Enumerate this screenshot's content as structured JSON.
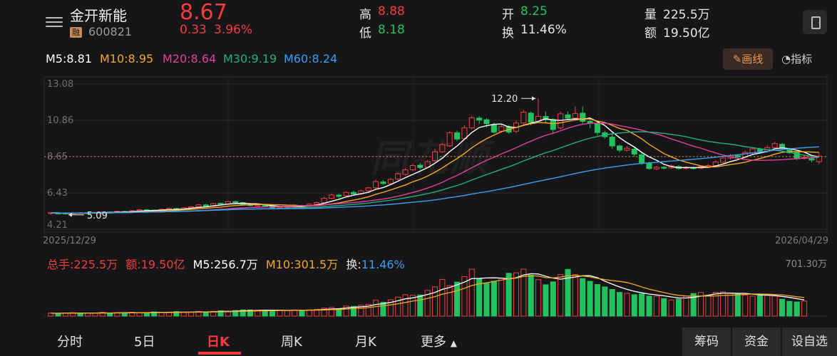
{
  "header": {
    "stock_name": "金开新能",
    "badge": "融",
    "stock_code": "600821",
    "price": "8.67",
    "change": "0.33",
    "change_pct": "3.96%",
    "high_label": "高",
    "high_value": "8.88",
    "low_label": "低",
    "low_value": "8.18",
    "open_label": "开",
    "open_value": "8.25",
    "turnover_label": "换",
    "turnover_value": "11.46%",
    "volume_label": "量",
    "volume_value": "225.5万",
    "amount_label": "额",
    "amount_value": "19.50亿"
  },
  "ma": {
    "m5": "M5:8.81",
    "m10": "M10:8.95",
    "m20": "M20:8.64",
    "m30": "M30:9.19",
    "m60": "M60:8.24"
  },
  "tools": {
    "draw": "画线",
    "indicator": "指标"
  },
  "watermark": "同花顺",
  "colors": {
    "up": "#f23d3d",
    "down": "#22c35e",
    "m5": "#ffffff",
    "m10": "#f5a623",
    "m20": "#e0409a",
    "m30": "#22b07d",
    "m60": "#3d9df0"
  },
  "chart_data": {
    "type": "candlestick",
    "y_ticks": [
      "13.08",
      "10.86",
      "8.65",
      "6.43",
      "4.21"
    ],
    "ylim": [
      4.21,
      13.08
    ],
    "current_price": 8.65,
    "x_start": "2025/12/29",
    "x_end": "2026/04/29",
    "max_annotation": "12.20",
    "max_value": 12.2,
    "min_annotation": "5.09",
    "min_value": 5.09,
    "candles": [
      [
        5.18,
        5.22,
        5.1,
        5.24
      ],
      [
        5.2,
        5.19,
        5.15,
        5.25
      ],
      [
        5.2,
        5.16,
        5.09,
        5.24
      ],
      [
        5.16,
        5.2,
        5.12,
        5.24
      ],
      [
        5.18,
        5.22,
        5.14,
        5.25
      ],
      [
        5.22,
        5.2,
        5.15,
        5.26
      ],
      [
        5.2,
        5.24,
        5.16,
        5.28
      ],
      [
        5.24,
        5.26,
        5.2,
        5.3
      ],
      [
        5.26,
        5.24,
        5.2,
        5.3
      ],
      [
        5.24,
        5.3,
        5.2,
        5.34
      ],
      [
        5.3,
        5.28,
        5.22,
        5.34
      ],
      [
        5.28,
        5.34,
        5.24,
        5.38
      ],
      [
        5.34,
        5.4,
        5.3,
        5.45
      ],
      [
        5.4,
        5.38,
        5.32,
        5.44
      ],
      [
        5.38,
        5.36,
        5.3,
        5.42
      ],
      [
        5.36,
        5.42,
        5.32,
        5.48
      ],
      [
        5.42,
        5.48,
        5.38,
        5.52
      ],
      [
        5.48,
        5.44,
        5.4,
        5.52
      ],
      [
        5.44,
        5.52,
        5.4,
        5.56
      ],
      [
        5.52,
        5.58,
        5.46,
        5.62
      ],
      [
        5.58,
        5.7,
        5.52,
        5.76
      ],
      [
        5.7,
        5.62,
        5.56,
        5.76
      ],
      [
        5.62,
        5.78,
        5.58,
        5.82
      ],
      [
        5.8,
        5.74,
        5.68,
        5.84
      ],
      [
        5.74,
        5.9,
        5.7,
        5.96
      ],
      [
        5.9,
        5.84,
        5.76,
        5.96
      ],
      [
        5.84,
        5.72,
        5.66,
        5.88
      ],
      [
        5.72,
        5.66,
        5.6,
        5.78
      ],
      [
        5.66,
        5.7,
        5.6,
        5.76
      ],
      [
        5.7,
        5.62,
        5.56,
        5.74
      ],
      [
        5.62,
        5.52,
        5.46,
        5.66
      ],
      [
        5.52,
        5.56,
        5.48,
        5.62
      ],
      [
        5.56,
        5.6,
        5.5,
        5.64
      ],
      [
        5.6,
        5.66,
        5.54,
        5.72
      ],
      [
        5.66,
        5.62,
        5.56,
        5.7
      ],
      [
        5.64,
        5.74,
        5.6,
        5.8
      ],
      [
        5.74,
        5.84,
        5.7,
        5.9
      ],
      [
        5.84,
        6.1,
        5.8,
        6.2
      ],
      [
        6.1,
        6.3,
        6.04,
        6.4
      ],
      [
        6.3,
        6.22,
        6.1,
        6.38
      ],
      [
        6.26,
        6.46,
        6.2,
        6.52
      ],
      [
        6.46,
        6.36,
        6.28,
        6.56
      ],
      [
        6.38,
        6.56,
        6.3,
        6.62
      ],
      [
        6.56,
        6.74,
        6.5,
        6.8
      ],
      [
        6.74,
        7.12,
        6.68,
        7.24
      ],
      [
        7.1,
        7.0,
        6.92,
        7.22
      ],
      [
        7.0,
        7.26,
        6.94,
        7.34
      ],
      [
        7.28,
        7.6,
        7.2,
        7.66
      ],
      [
        7.56,
        7.84,
        7.48,
        7.94
      ],
      [
        7.84,
        8.1,
        7.76,
        8.2
      ],
      [
        8.12,
        7.98,
        7.88,
        8.24
      ],
      [
        8.0,
        8.34,
        7.94,
        8.44
      ],
      [
        8.4,
        8.94,
        8.32,
        9.12
      ],
      [
        8.94,
        9.38,
        8.88,
        9.48
      ],
      [
        9.3,
        10.1,
        9.24,
        10.2
      ],
      [
        10.1,
        9.72,
        9.6,
        10.24
      ],
      [
        9.74,
        10.4,
        9.68,
        10.56
      ],
      [
        10.4,
        11.02,
        10.3,
        11.14
      ],
      [
        11.0,
        10.88,
        10.64,
        11.12
      ],
      [
        10.9,
        10.66,
        10.42,
        11.0
      ],
      [
        10.6,
        10.14,
        10.04,
        10.72
      ],
      [
        10.2,
        10.48,
        10.1,
        10.62
      ],
      [
        10.48,
        10.14,
        10.04,
        10.58
      ],
      [
        10.2,
        10.7,
        10.08,
        10.84
      ],
      [
        10.7,
        11.36,
        10.6,
        11.5
      ],
      [
        11.3,
        10.74,
        10.56,
        11.4
      ],
      [
        10.8,
        11.1,
        10.7,
        12.2
      ],
      [
        11.1,
        10.9,
        10.7,
        11.4
      ],
      [
        10.92,
        10.3,
        10.1,
        11.0
      ],
      [
        10.4,
        11.26,
        10.3,
        11.4
      ],
      [
        11.2,
        11.0,
        10.86,
        11.4
      ],
      [
        11.0,
        11.28,
        10.9,
        11.7
      ],
      [
        11.3,
        10.8,
        10.6,
        11.7
      ],
      [
        10.8,
        10.7,
        10.4,
        10.94
      ],
      [
        10.66,
        10.12,
        9.94,
        10.8
      ],
      [
        10.1,
        9.86,
        9.74,
        10.22
      ],
      [
        9.84,
        9.3,
        9.12,
        10.06
      ],
      [
        9.3,
        9.04,
        8.9,
        9.4
      ],
      [
        9.04,
        9.16,
        8.96,
        9.3
      ],
      [
        9.1,
        8.8,
        8.66,
        9.2
      ],
      [
        8.76,
        8.24,
        8.14,
        8.9
      ],
      [
        8.24,
        7.92,
        7.84,
        8.34
      ],
      [
        7.9,
        8.0,
        7.82,
        8.08
      ],
      [
        8.0,
        7.94,
        7.86,
        8.06
      ],
      [
        7.96,
        8.08,
        7.9,
        8.16
      ],
      [
        8.04,
        7.92,
        7.84,
        8.12
      ],
      [
        7.94,
        7.98,
        7.86,
        8.06
      ],
      [
        7.98,
        7.92,
        7.86,
        8.06
      ],
      [
        7.94,
        8.04,
        7.88,
        8.12
      ],
      [
        8.04,
        8.1,
        7.96,
        8.18
      ],
      [
        8.1,
        8.32,
        8.04,
        8.4
      ],
      [
        8.3,
        8.56,
        8.24,
        8.66
      ],
      [
        8.56,
        8.7,
        8.46,
        8.8
      ],
      [
        8.7,
        8.62,
        8.52,
        8.8
      ],
      [
        8.62,
        8.9,
        8.56,
        9.02
      ],
      [
        8.88,
        9.12,
        8.8,
        9.2
      ],
      [
        9.1,
        8.98,
        8.88,
        9.2
      ],
      [
        8.98,
        9.2,
        8.9,
        9.34
      ],
      [
        9.2,
        9.44,
        9.1,
        9.56
      ],
      [
        9.4,
        9.16,
        9.06,
        9.48
      ],
      [
        9.14,
        8.88,
        8.8,
        9.2
      ],
      [
        8.9,
        8.52,
        8.44,
        8.96
      ],
      [
        8.54,
        8.6,
        8.46,
        8.72
      ],
      [
        8.52,
        8.44,
        8.3,
        8.64
      ],
      [
        8.34,
        8.67,
        8.18,
        8.88
      ]
    ]
  },
  "volume": {
    "total": "总手:225.5万",
    "amount": "额:19.50亿",
    "m5": "M5:256.7万",
    "m10": "M10:301.5万",
    "turnover_label": "换:",
    "turnover_value": "11.46%",
    "max": "701.30万",
    "max_value": 701.3,
    "bars": [
      44,
      40,
      46,
      52,
      42,
      48,
      46,
      56,
      44,
      50,
      52,
      58,
      48,
      54,
      62,
      56,
      60,
      66,
      54,
      62,
      70,
      64,
      72,
      80,
      68,
      84,
      94,
      92,
      88,
      86,
      84,
      90,
      82,
      92,
      88,
      94,
      100,
      120,
      128,
      112,
      150,
      146,
      162,
      176,
      236,
      208,
      244,
      284,
      320,
      312,
      316,
      384,
      436,
      548,
      456,
      508,
      590,
      700,
      560,
      490,
      520,
      566,
      640,
      646,
      701,
      614,
      544,
      468,
      512,
      620,
      698,
      620,
      560,
      520,
      472,
      436,
      398,
      354,
      340,
      320,
      332,
      300,
      298,
      262,
      242,
      256,
      298,
      338,
      354,
      312,
      356,
      362,
      338,
      330,
      312,
      298,
      304,
      320,
      300,
      252,
      220,
      212,
      225
    ],
    "bar_up": [
      1,
      0,
      1,
      1,
      0,
      1,
      1,
      1,
      0,
      1,
      0,
      1,
      1,
      0,
      0,
      1,
      1,
      0,
      1,
      1,
      1,
      0,
      1,
      0,
      1,
      0,
      0,
      0,
      1,
      0,
      0,
      1,
      1,
      1,
      0,
      1,
      1,
      1,
      1,
      0,
      1,
      0,
      1,
      1,
      1,
      0,
      1,
      1,
      1,
      1,
      0,
      1,
      1,
      1,
      1,
      0,
      1,
      1,
      0,
      0,
      0,
      1,
      0,
      1,
      1,
      0,
      1,
      0,
      0,
      1,
      0,
      1,
      0,
      0,
      0,
      0,
      0,
      0,
      1,
      0,
      0,
      0,
      1,
      0,
      1,
      0,
      1,
      0,
      1,
      1,
      1,
      1,
      1,
      0,
      1,
      1,
      0,
      1,
      1,
      0,
      0,
      0,
      1,
      0,
      1
    ]
  },
  "tabs": {
    "items": [
      "分时",
      "5日",
      "日K",
      "周K",
      "月K",
      "更多"
    ],
    "caret": "▲",
    "right_buttons": [
      "筹码",
      "资金",
      "设自选"
    ]
  }
}
